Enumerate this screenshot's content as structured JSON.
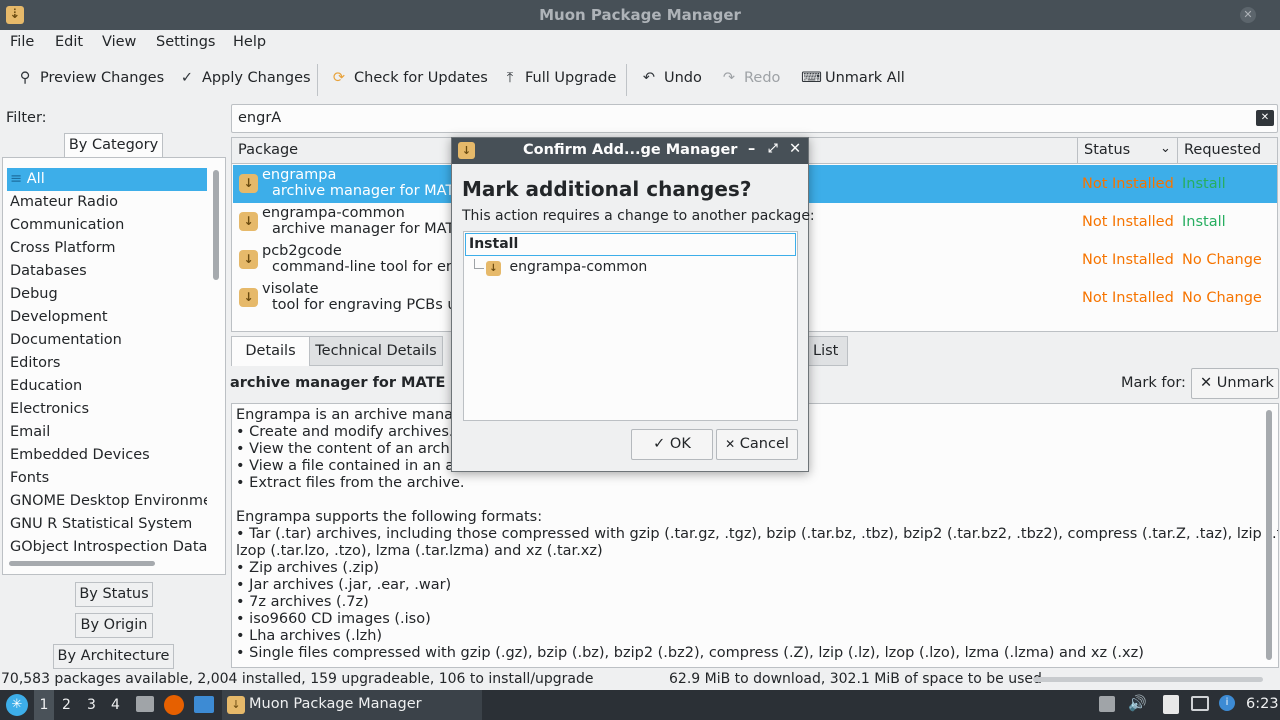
{
  "window": {
    "title": "Muon Package Manager"
  },
  "menu": [
    "File",
    "Edit",
    "View",
    "Settings",
    "Help"
  ],
  "toolbar": {
    "preview": "Preview Changes",
    "apply": "Apply Changes",
    "check": "Check for Updates",
    "upgrade": "Full Upgrade",
    "undo": "Undo",
    "redo": "Redo",
    "unmark": "Unmark All"
  },
  "filter": {
    "label": "Filter:",
    "search_value": "engrA"
  },
  "side_tabs": {
    "by_category": "By Category",
    "by_status": "By Status",
    "by_origin": "By Origin",
    "by_architecture": "By Architecture"
  },
  "categories": [
    "All",
    "Amateur Radio",
    "Communication",
    "Cross Platform",
    "Databases",
    "Debug",
    "Development",
    "Documentation",
    "Editors",
    "Education",
    "Electronics",
    "Email",
    "Embedded Devices",
    "Fonts",
    "GNOME Desktop Environmen",
    "GNU R Statistical System",
    "GObject Introspection Data"
  ],
  "table": {
    "headers": {
      "package": "Package",
      "status": "Status",
      "requested": "Requested"
    },
    "rows": [
      {
        "name": "engrampa",
        "desc": "archive manager for MATE",
        "status": "Not Installed",
        "requested": "Install"
      },
      {
        "name": "engrampa-common",
        "desc": "archive manager for MATE",
        "status": "Not Installed",
        "requested": "Install"
      },
      {
        "name": "pcb2gcode",
        "desc": "command-line tool for eng",
        "status": "Not Installed",
        "requested": "No Change"
      },
      {
        "name": "visolate",
        "desc": "tool for engraving PCBs us",
        "status": "Not Installed",
        "requested": "No Change"
      }
    ]
  },
  "detail_tabs": {
    "details": "Details",
    "technical": "Technical Details",
    "list": "List"
  },
  "details": {
    "heading": "archive manager for MATE",
    "mark_for": "Mark for:",
    "unmark": "Unmark",
    "lines": [
      "Engrampa is an archive manage",
      " • Create and modify archives.",
      " • View the content of an archive",
      " • View a file contained in an arc",
      " • Extract files from the archive.",
      "",
      "Engrampa supports the following formats:",
      " • Tar (.tar) archives, including those compressed with gzip (.tar.gz, .tgz), bzip (.tar.bz, .tbz), bzip2 (.tar.bz2, .tbz2), compress (.tar.Z, .taz), lzip (.tar.lz, .tlz),",
      "lzop (.tar.lzo, .tzo), lzma (.tar.lzma) and xz (.tar.xz)",
      " • Zip archives (.zip)",
      " • Jar archives (.jar, .ear, .war)",
      " • 7z archives (.7z)",
      " • iso9660 CD images (.iso)",
      " • Lha archives (.lzh)",
      " • Single files compressed with gzip (.gz), bzip (.bz), bzip2 (.bz2), compress (.Z), lzip (.lz), lzop (.lzo), lzma (.lzma) and xz (.xz)"
    ]
  },
  "status_bar": {
    "left": "70,583 packages available, 2,004 installed, 159 upgradeable, 106 to install/upgrade",
    "right": "62.9 MiB to download, 302.1 MiB of space to be used"
  },
  "dialog": {
    "title": "Confirm Add...ge Manager",
    "heading": "Mark additional changes?",
    "message": "This action requires a change to another package:",
    "tree_header": "Install",
    "tree_item": "engrampa-common",
    "ok": "OK",
    "cancel": "Cancel"
  },
  "taskbar": {
    "workspaces": [
      "1",
      "2",
      "3",
      "4"
    ],
    "task": "Muon Package Manager",
    "clock": "6:23"
  },
  "colors": {
    "selection": "#3daee9",
    "not_installed": "#f67400",
    "install": "#27ae60",
    "titlebar": "#475057"
  }
}
